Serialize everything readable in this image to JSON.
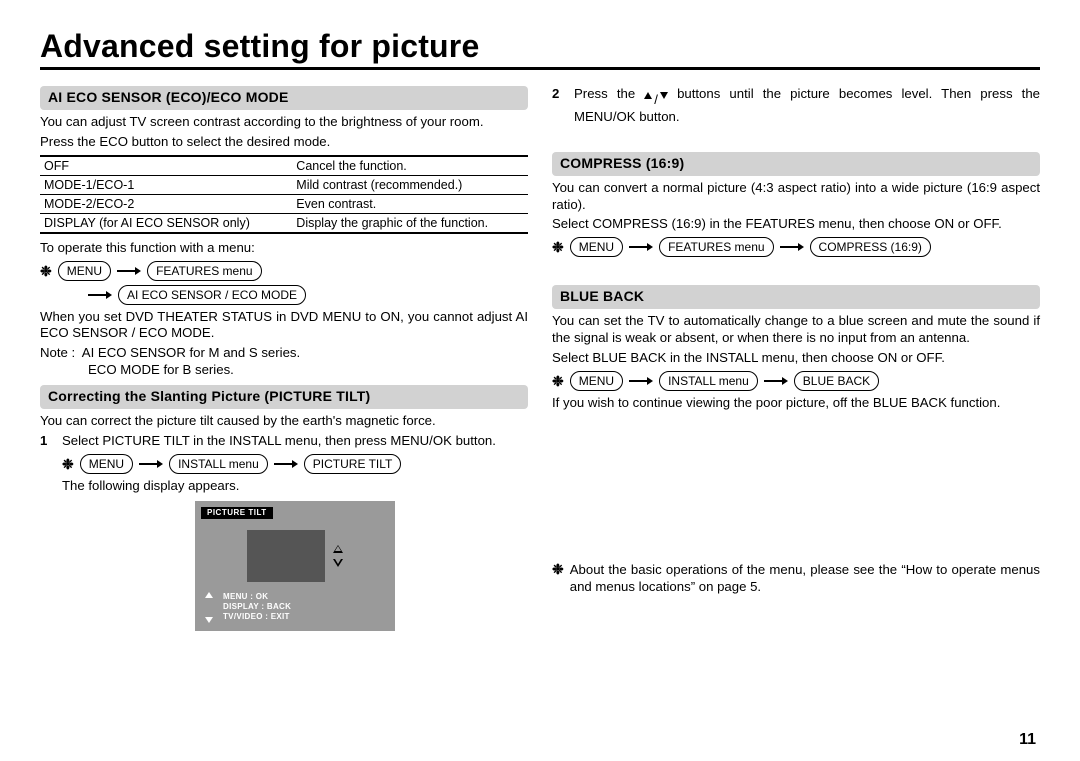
{
  "page": {
    "title": "Advanced setting for picture",
    "number": "11"
  },
  "left": {
    "sec1": {
      "heading": "AI ECO SENSOR (ECO)/ECO MODE",
      "p1": "You can adjust TV screen contrast according to the brightness of your room.",
      "p2": "Press the ECO button to select the desired mode.",
      "table": [
        [
          "OFF",
          "Cancel the function."
        ],
        [
          "MODE-1/ECO-1",
          "Mild contrast (recommended.)"
        ],
        [
          "MODE-2/ECO-2",
          "Even contrast."
        ],
        [
          "DISPLAY (for AI ECO SENSOR only)",
          "Display the graphic of the function."
        ]
      ],
      "p3": "To operate this function with a menu:",
      "nav": [
        "MENU",
        "FEATURES menu",
        "AI ECO SENSOR / ECO MODE"
      ],
      "p4": "When you set DVD THEATER STATUS in DVD MENU to ON, you cannot adjust AI ECO SENSOR / ECO MODE.",
      "p5a": "Note :  AI ECO SENSOR for M and S series.",
      "p5b": "ECO MODE for B series."
    },
    "sec2": {
      "heading": "Correcting the Slanting Picture (PICTURE TILT)",
      "p1": "You can correct the picture tilt caused by the earth's magnetic force.",
      "step1a": "Select PICTURE TILT in the INSTALL menu, then press MENU/OK button.",
      "nav": [
        "MENU",
        "INSTALL menu",
        "PICTURE TILT"
      ],
      "step1b": "The following display appears.",
      "osd": {
        "title": "PICTURE TILT",
        "lines": [
          "MENU : OK",
          "DISPLAY : BACK",
          "TV/VIDEO : EXIT"
        ]
      }
    }
  },
  "right": {
    "step2_pre": "Press the ",
    "step2_post": " buttons until the picture becomes level. Then press the MENU/OK button.",
    "compress": {
      "heading": "COMPRESS (16:9)",
      "p1": "You can convert a normal picture (4:3 aspect ratio) into a wide picture (16:9 aspect ratio).",
      "p2": "Select COMPRESS (16:9) in the FEATURES menu, then choose ON or OFF.",
      "nav": [
        "MENU",
        "FEATURES menu",
        "COMPRESS (16:9)"
      ]
    },
    "blueback": {
      "heading": "BLUE BACK",
      "p1": "You can set the TV to automatically change to a blue screen and mute the sound if the signal is weak or absent, or when there is no input from an antenna.",
      "p2": "Select BLUE BACK in the INSTALL menu, then choose ON or OFF.",
      "nav": [
        "MENU",
        "INSTALL menu",
        "BLUE BACK"
      ],
      "p3": "If you wish to continue viewing the poor picture, off the BLUE BACK function."
    },
    "footnote": "About the basic operations of the menu, please see the “How to operate menus and menus locations” on page 5."
  },
  "glyphs": {
    "asterisk": "❉",
    "slash": "/"
  }
}
